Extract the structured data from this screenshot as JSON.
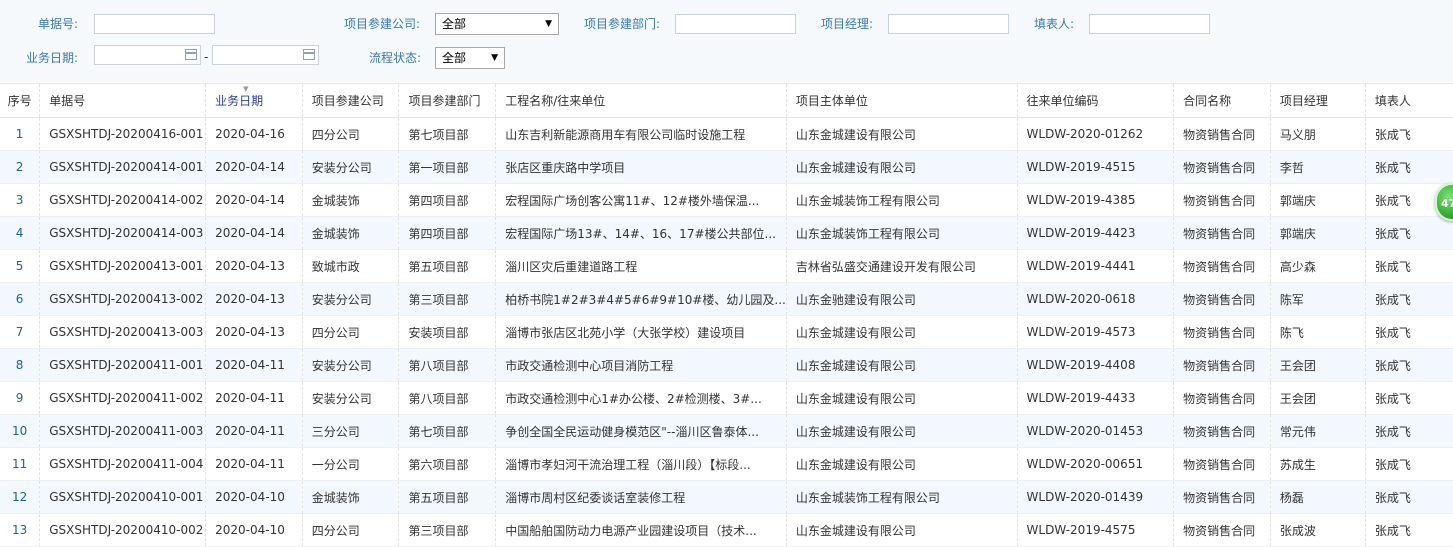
{
  "filters": {
    "doc_no_label": "单据号:",
    "company_label": "项目参建公司:",
    "company_value": "全部",
    "dept_label": "项目参建部门:",
    "manager_label": "项目经理:",
    "filler_label": "填表人:",
    "date_label": "业务日期:",
    "date_sep": "-",
    "status_label": "流程状态:",
    "status_value": "全部"
  },
  "table": {
    "headers": [
      "序号",
      "单据号",
      "业务日期",
      "项目参建公司",
      "项目参建部门",
      "工程名称/往来单位",
      "项目主体单位",
      "往来单位编码",
      "合同名称",
      "项目经理",
      "填表人"
    ],
    "rows": [
      [
        "1",
        "GSXSHTDJ-20200416-001",
        "2020-04-16",
        "四分公司",
        "第七项目部",
        "山东吉利新能源商用车有限公司临时设施工程",
        "山东金城建设有限公司",
        "WLDW-2020-01262",
        "物资销售合同",
        "马义朋",
        "张成飞"
      ],
      [
        "2",
        "GSXSHTDJ-20200414-001",
        "2020-04-14",
        "安装分公司",
        "第一项目部",
        "张店区重庆路中学项目",
        "山东金城建设有限公司",
        "WLDW-2019-4515",
        "物资销售合同",
        "李哲",
        "张成飞"
      ],
      [
        "3",
        "GSXSHTDJ-20200414-002",
        "2020-04-14",
        "金城装饰",
        "第四项目部",
        "宏程国际广场创客公寓11#、12#楼外墙保温...",
        "山东金城装饰工程有限公司",
        "WLDW-2019-4385",
        "物资销售合同",
        "郭端庆",
        "张成飞"
      ],
      [
        "4",
        "GSXSHTDJ-20200414-003",
        "2020-04-14",
        "金城装饰",
        "第四项目部",
        "宏程国际广场13#、14#、16、17#楼公共部位...",
        "山东金城装饰工程有限公司",
        "WLDW-2019-4423",
        "物资销售合同",
        "郭端庆",
        "张成飞"
      ],
      [
        "5",
        "GSXSHTDJ-20200413-001",
        "2020-04-13",
        "致城市政",
        "第五项目部",
        "淄川区灾后重建道路工程",
        "吉林省弘盛交通建设开发有限公司",
        "WLDW-2019-4441",
        "物资销售合同",
        "高少森",
        "张成飞"
      ],
      [
        "6",
        "GSXSHTDJ-20200413-002",
        "2020-04-13",
        "安装分公司",
        "第三项目部",
        "柏桥书院1#2#3#4#5#6#9#10#楼、幼儿园及...",
        "山东金驰建设有限公司",
        "WLDW-2020-0618",
        "物资销售合同",
        "陈军",
        "张成飞"
      ],
      [
        "7",
        "GSXSHTDJ-20200413-003",
        "2020-04-13",
        "四分公司",
        "安装项目部",
        "淄博市张店区北苑小学（大张学校）建设项目",
        "山东金城建设有限公司",
        "WLDW-2019-4573",
        "物资销售合同",
        "陈飞",
        "张成飞"
      ],
      [
        "8",
        "GSXSHTDJ-20200411-001",
        "2020-04-11",
        "安装分公司",
        "第八项目部",
        "市政交通检测中心项目消防工程",
        "山东金城建设有限公司",
        "WLDW-2019-4408",
        "物资销售合同",
        "王会团",
        "张成飞"
      ],
      [
        "9",
        "GSXSHTDJ-20200411-002",
        "2020-04-11",
        "安装分公司",
        "第八项目部",
        "市政交通检测中心1#办公楼、2#检测楼、3#...",
        "山东金城建设有限公司",
        "WLDW-2019-4433",
        "物资销售合同",
        "王会团",
        "张成飞"
      ],
      [
        "10",
        "GSXSHTDJ-20200411-003",
        "2020-04-11",
        "三分公司",
        "第七项目部",
        "争创全国全民运动健身模范区\"--淄川区鲁泰体...",
        "山东金城建设有限公司",
        "WLDW-2020-01453",
        "物资销售合同",
        "常元伟",
        "张成飞"
      ],
      [
        "11",
        "GSXSHTDJ-20200411-004",
        "2020-04-11",
        "一分公司",
        "第六项目部",
        "淄博市孝妇河干流治理工程（淄川段）【标段...",
        "山东金城建设有限公司",
        "WLDW-2020-00651",
        "物资销售合同",
        "苏成生",
        "张成飞"
      ],
      [
        "12",
        "GSXSHTDJ-20200410-001",
        "2020-04-10",
        "金城装饰",
        "第五项目部",
        "淄博市周村区纪委谈话室装修工程",
        "山东金城装饰工程有限公司",
        "WLDW-2020-01439",
        "物资销售合同",
        "杨磊",
        "张成飞"
      ],
      [
        "13",
        "GSXSHTDJ-20200410-002",
        "2020-04-10",
        "四分公司",
        "第三项目部",
        "中国船舶国防动力电源产业园建设项目（技术...",
        "山东金城建设有限公司",
        "WLDW-2019-4575",
        "物资销售合同",
        "张成波",
        "张成飞"
      ]
    ]
  },
  "badge": {
    "text": "47"
  }
}
